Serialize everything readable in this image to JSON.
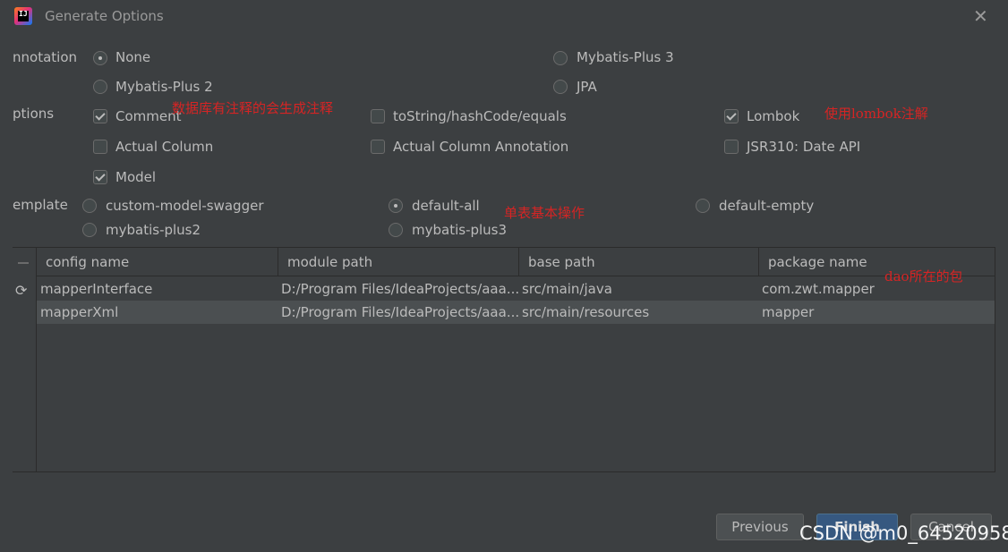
{
  "window": {
    "title": "Generate Options",
    "icon": "intellij-app-icon",
    "close_icon": "close-icon"
  },
  "annotation": {
    "label": "nnotation",
    "options": [
      {
        "label": "None",
        "checked": true
      },
      {
        "label": "Mybatis-Plus 3",
        "checked": false
      },
      {
        "label": "Mybatis-Plus 2",
        "checked": false
      },
      {
        "label": "JPA",
        "checked": false
      }
    ]
  },
  "options": {
    "label": "ptions",
    "items": [
      {
        "label": "Comment",
        "checked": true
      },
      {
        "label": "toString/hashCode/equals",
        "checked": false
      },
      {
        "label": "Lombok",
        "checked": true
      },
      {
        "label": "Actual Column",
        "checked": false
      },
      {
        "label": "Actual Column Annotation",
        "checked": false
      },
      {
        "label": "JSR310: Date API",
        "checked": false
      },
      {
        "label": "Model",
        "checked": true
      }
    ]
  },
  "template": {
    "label": "emplate",
    "options": [
      {
        "label": "custom-model-swagger",
        "checked": false
      },
      {
        "label": "default-all",
        "checked": true
      },
      {
        "label": "default-empty",
        "checked": false
      },
      {
        "label": "mybatis-plus2",
        "checked": false
      },
      {
        "label": "mybatis-plus3",
        "checked": false
      }
    ]
  },
  "annotations_overlay": {
    "comment_note": "数据库有注释的会生成注释",
    "lombok_note": "使用lombok注解",
    "default_all_note": "单表基本操作",
    "package_note": "dao所在的包"
  },
  "table": {
    "columns": [
      "config name",
      "module path",
      "base path",
      "package name"
    ],
    "rows": [
      {
        "config_name": "mapperInterface",
        "module_path": "D:/Program Files/IdeaProjects/aaa...",
        "base_path": "src/main/java",
        "package_name": "com.zwt.mapper"
      },
      {
        "config_name": "mapperXml",
        "module_path": "D:/Program Files/IdeaProjects/aaa...",
        "base_path": "src/main/resources",
        "package_name": "mapper"
      }
    ]
  },
  "buttons": {
    "previous": "Previous",
    "finish": "Finish",
    "cancel": "Cancel"
  },
  "watermark": "CSDN @m0_64520958",
  "colors": {
    "background": "#3c3f41",
    "accent": "#365880",
    "annotation_red": "#d62424"
  }
}
